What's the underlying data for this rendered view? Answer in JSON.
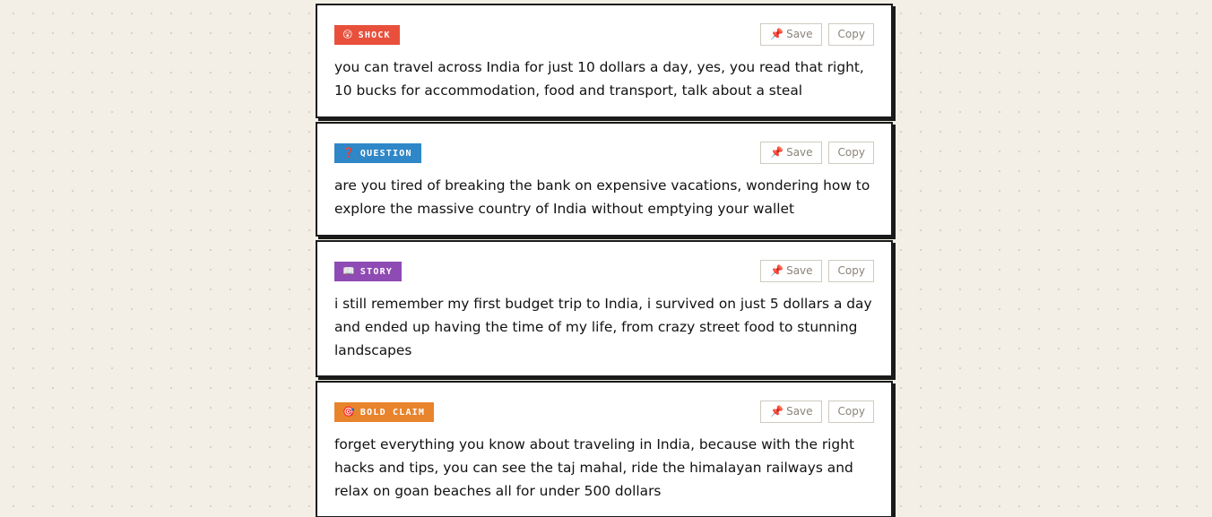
{
  "cards": [
    {
      "tag_icon": "😲",
      "tag_label": "SHOCK",
      "tag_color": "#e8503c",
      "save_label": "Save",
      "copy_label": "Copy",
      "text": "you can travel across India for just 10 dollars a day, yes, you read that right, 10 bucks for accommodation, food and transport, talk about a steal"
    },
    {
      "tag_icon": "❓",
      "tag_label": "QUESTION",
      "tag_color": "#2f87c8",
      "save_label": "Save",
      "copy_label": "Copy",
      "text": "are you tired of breaking the bank on expensive vacations, wondering how to explore the massive country of India without emptying your wallet"
    },
    {
      "tag_icon": "📖",
      "tag_label": "STORY",
      "tag_color": "#8e4bb3",
      "save_label": "Save",
      "copy_label": "Copy",
      "text": "i still remember my first budget trip to India, i survived on just 5 dollars a day and ended up having the time of my life, from crazy street food to stunning landscapes"
    },
    {
      "tag_icon": "🎯",
      "tag_label": "BOLD CLAIM",
      "tag_color": "#e8842c",
      "save_label": "Save",
      "copy_label": "Copy",
      "text": "forget everything you know about traveling in India, because with the right hacks and tips, you can see the taj mahal, ride the himalayan railways and relax on goan beaches all for under 500 dollars"
    }
  ],
  "icons": {
    "save": "pin-icon"
  }
}
